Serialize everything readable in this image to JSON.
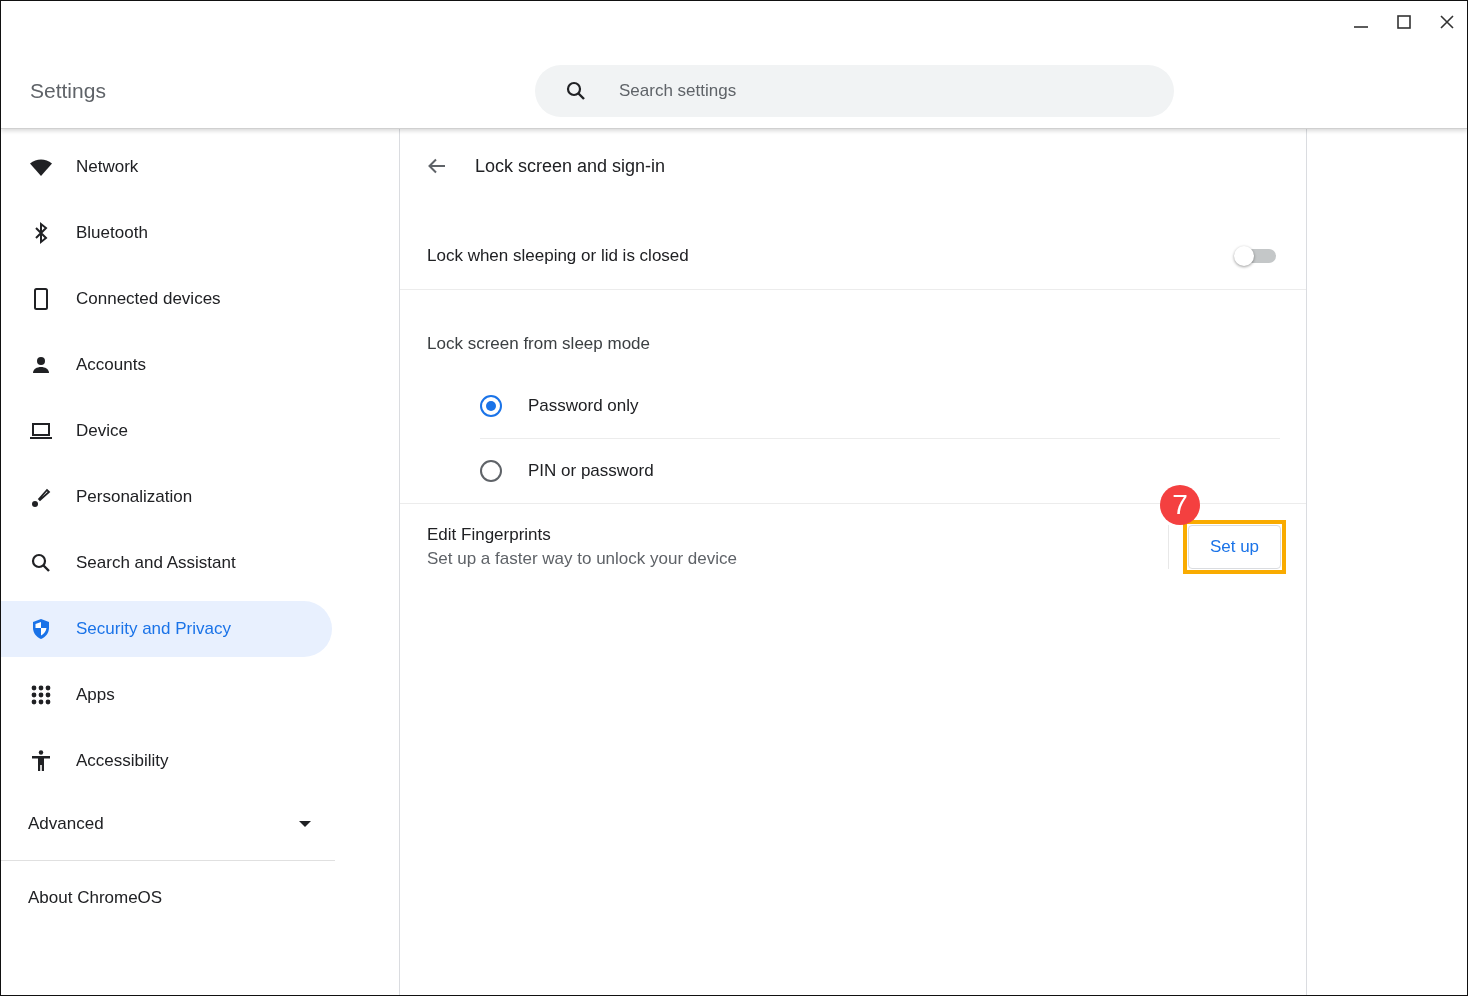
{
  "window": {
    "title": "Settings"
  },
  "search": {
    "placeholder": "Search settings"
  },
  "sidebar": {
    "items": [
      {
        "label": "Network",
        "kind": "wifi",
        "selected": false
      },
      {
        "label": "Bluetooth",
        "kind": "bluetooth",
        "selected": false
      },
      {
        "label": "Connected devices",
        "kind": "phone",
        "selected": false
      },
      {
        "label": "Accounts",
        "kind": "person",
        "selected": false
      },
      {
        "label": "Device",
        "kind": "laptop",
        "selected": false
      },
      {
        "label": "Personalization",
        "kind": "brush",
        "selected": false
      },
      {
        "label": "Search and Assistant",
        "kind": "search",
        "selected": false
      },
      {
        "label": "Security and Privacy",
        "kind": "shield",
        "selected": true
      },
      {
        "label": "Apps",
        "kind": "grid",
        "selected": false
      },
      {
        "label": "Accessibility",
        "kind": "accessibility",
        "selected": false
      }
    ],
    "advanced": {
      "label": "Advanced",
      "expanded": false
    },
    "about": "About ChromeOS"
  },
  "page": {
    "title": "Lock screen and sign-in",
    "lock_toggle": {
      "label": "Lock when sleeping or lid is closed",
      "on": false
    },
    "sleep_mode": {
      "heading": "Lock screen from sleep mode",
      "options": [
        {
          "label": "Password only",
          "selected": true
        },
        {
          "label": "PIN or password",
          "selected": false
        }
      ]
    },
    "fingerprints": {
      "title": "Edit Fingerprints",
      "description": "Set up a faster way to unlock your device",
      "button": "Set up"
    }
  },
  "annotation": {
    "step": "7"
  }
}
